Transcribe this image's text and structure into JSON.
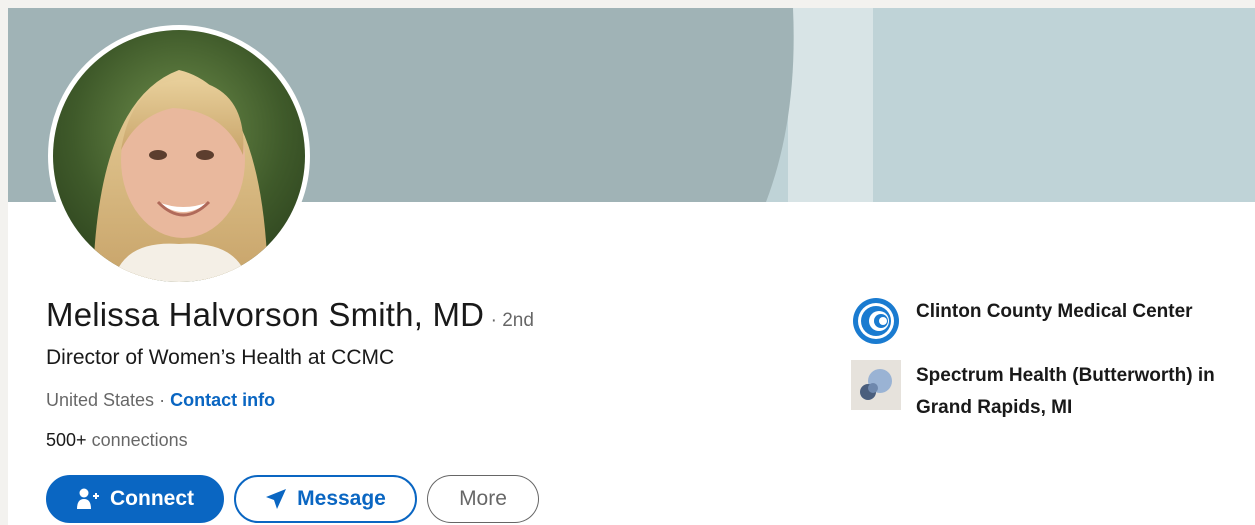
{
  "profile": {
    "name": "Melissa Halvorson Smith, MD",
    "degree": "· 2nd",
    "headline": "Director of Women’s Health at CCMC",
    "location": "United States",
    "separator": "·",
    "contact_label": "Contact info",
    "connections_count": "500+",
    "connections_label": "connections"
  },
  "actions": {
    "connect_label": "Connect",
    "message_label": "Message",
    "more_label": "More"
  },
  "organizations": [
    {
      "name": "Clinton County Medical Center",
      "logo": "ccmc-logo-icon"
    },
    {
      "name": "Spectrum Health (Butterworth) in Grand Rapids, MI",
      "logo": "spectrum-logo-icon"
    }
  ],
  "colors": {
    "brand_blue": "#0a66c2",
    "banner_dark": "#a0b3b6",
    "banner_light": "#bfd3d7",
    "banner_stripe": "#d8e4e6"
  }
}
